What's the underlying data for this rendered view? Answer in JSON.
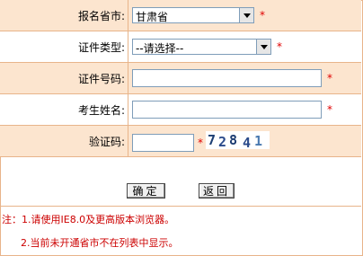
{
  "form": {
    "province": {
      "label": "报名省市:",
      "value": "甘肃省"
    },
    "cert_type": {
      "label": "证件类型:",
      "value": "--请选择--"
    },
    "cert_number": {
      "label": "证件号码:",
      "value": ""
    },
    "name": {
      "label": "考生姓名:",
      "value": ""
    },
    "captcha": {
      "label": "验证码:",
      "value": "",
      "image_text": [
        "7",
        "2",
        "8",
        "4",
        "1"
      ]
    },
    "required_mark": "*"
  },
  "buttons": {
    "confirm": "确定",
    "back": "返回"
  },
  "notes": {
    "line1": "注：1.请使用IE8.0及更高版本浏览器。",
    "line2": "2.当前未开通省市不在列表中显示。"
  },
  "colors": {
    "row_tint": "#fce5cf",
    "border": "#e8b48a",
    "required": "#e00000",
    "note": "#cc0000"
  }
}
